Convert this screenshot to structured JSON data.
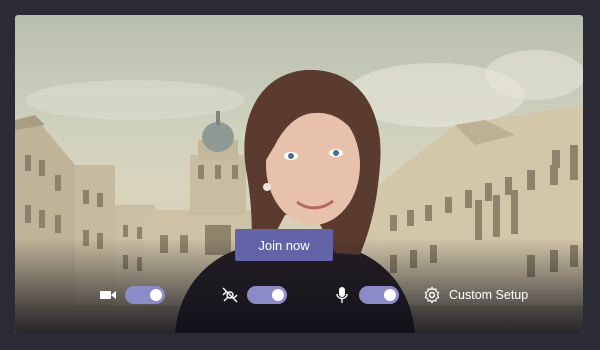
{
  "join": {
    "label": "Join now"
  },
  "controls": {
    "camera": {
      "icon": "video-camera-icon",
      "on": true
    },
    "background_blur": {
      "icon": "background-blur-icon",
      "on": true
    },
    "microphone": {
      "icon": "microphone-icon",
      "on": true
    },
    "custom_setup": {
      "icon": "gear-icon",
      "label": "Custom Setup"
    }
  },
  "colors": {
    "accent": "#6264a7",
    "toggle_track": "#8b8cc7",
    "frame": "#2b2b36"
  }
}
